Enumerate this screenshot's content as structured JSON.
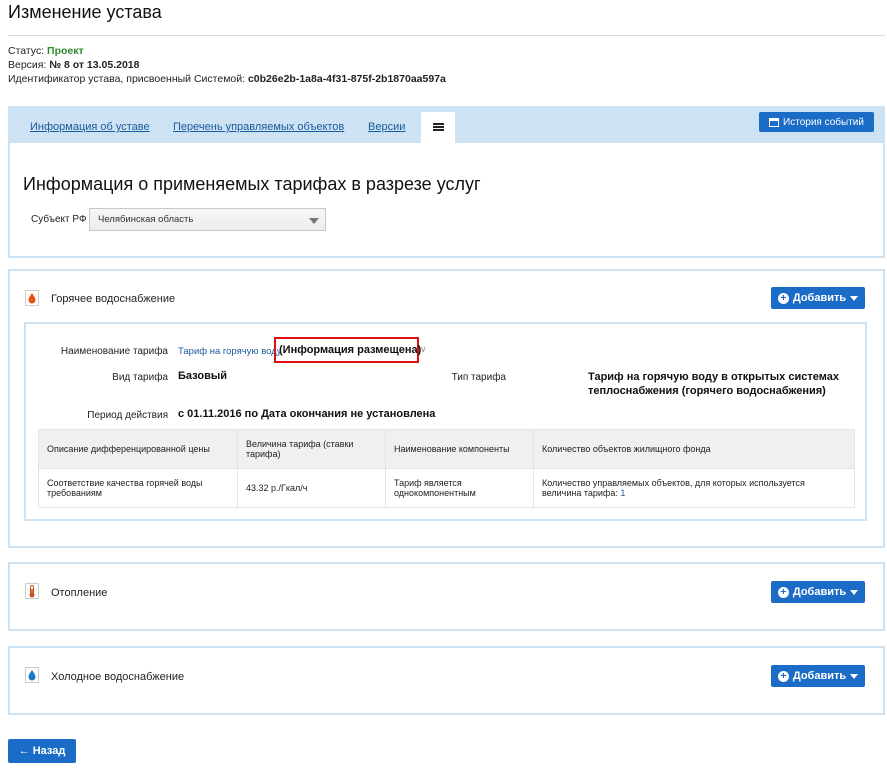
{
  "page": {
    "title": "Изменение устава"
  },
  "meta": {
    "status_label": "Статус:",
    "status_value": "Проект",
    "version_label": "Версия:",
    "version_value": "№ 8 от 13.05.2018",
    "id_label": "Идентификатор устава, присвоенный Системой:",
    "id_value": "c0b26e2b-1a8a-4f31-875f-2b1870aa597a"
  },
  "tabs": [
    {
      "label": "Информация об уставе"
    },
    {
      "label": "Перечень управляемых объектов"
    },
    {
      "label": "Версии"
    }
  ],
  "toolbar": {
    "history_label": "История событий"
  },
  "section": {
    "title": "Информация о применяемых тарифах в разрезе услуг",
    "subject_label": "Субъект РФ",
    "subject_value": "Челябинская область"
  },
  "services": [
    {
      "label": "Горячее водоснабжение",
      "icon": "drop-orange-icon"
    },
    {
      "label": "Отопление",
      "icon": "thermometer-icon"
    },
    {
      "label": "Холодное водоснабжение",
      "icon": "drop-blue-icon"
    }
  ],
  "add_label": "Добавить",
  "tariff": {
    "name_label": "Наименование тарифа",
    "name_link": "Тариф на горячую воду",
    "name_status": "(Информация размещена)",
    "kind_label": "Вид тарифа",
    "kind_value": "Базовый",
    "type_label": "Тип тарифа",
    "type_value": "Тариф на горячую воду в открытых системах теплоснабжения (горячего водоснабжения)",
    "period_label": "Период действия",
    "period_value": "с 01.11.2016 по Дата окончания не установлена"
  },
  "table": {
    "headers": [
      "Описание дифференцированной цены",
      "Величина тарифа (ставки тарифа)",
      "Наименование компоненты",
      "Количество объектов жилищного фонда"
    ],
    "row": {
      "desc": "Соответствие качества горячей воды требованиям",
      "value": "43.32 р./Гкал/ч",
      "component": "Тариф является однокомпонентным",
      "count_text": "Количество управляемых объектов, для которых используется величина тарифа:",
      "count_value": "1"
    }
  },
  "back_label": "Назад",
  "colors": {
    "accent": "#1a6cc7",
    "panel_border": "#cde3f3",
    "status_green": "#2e8b2e",
    "highlight": "#e01010"
  }
}
